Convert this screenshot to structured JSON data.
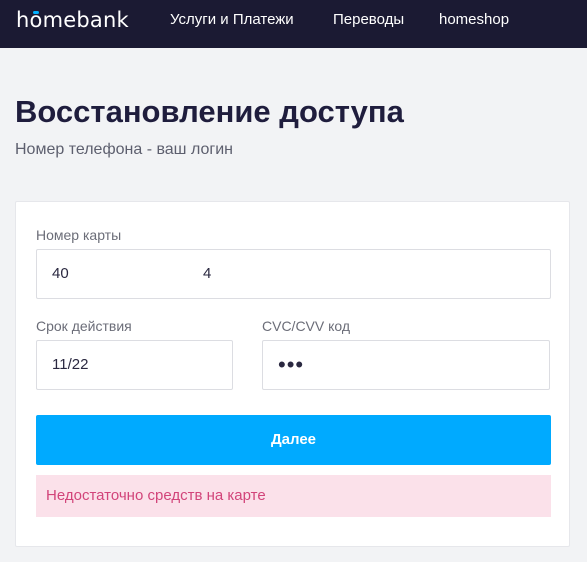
{
  "header": {
    "logo": {
      "before": "h",
      "ring": "o",
      "after": "mebank"
    },
    "nav": [
      "Услуги и Платежи",
      "Переводы",
      "homeshop"
    ]
  },
  "page": {
    "title": "Восстановление доступа",
    "subtitle": "Номер телефона - ваш логин"
  },
  "form": {
    "card_number": {
      "label": "Номер карты",
      "part1": "40",
      "part2": "4"
    },
    "expiry": {
      "label": "Срок действия",
      "value": "11/22"
    },
    "cvc": {
      "label": "CVC/CVV код",
      "value": "•••"
    },
    "submit_label": "Далее",
    "error": "Недостаточно средств на карте"
  },
  "colors": {
    "navbar": "#1b1a33",
    "accent": "#00aaff",
    "error_bg": "#fbe1ea",
    "error_text": "#d2447a"
  }
}
